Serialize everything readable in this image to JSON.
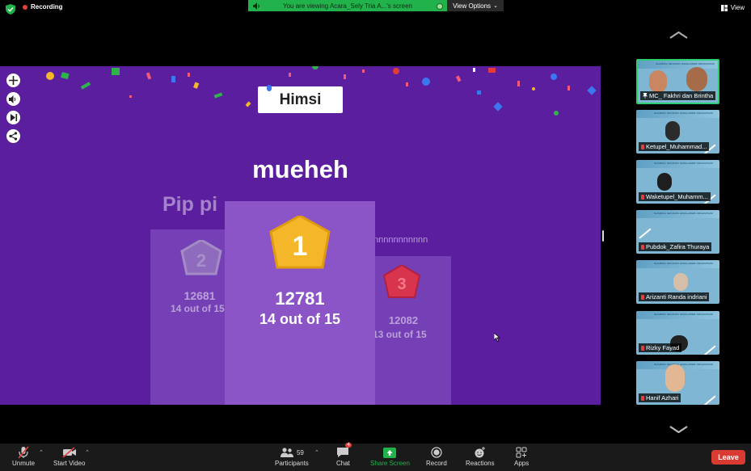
{
  "topbar": {
    "recording_label": "Recording",
    "banner_text": "You are viewing Acara_Sely Tria A...'s screen",
    "view_options_label": "View Options",
    "view_label": "View"
  },
  "screen": {
    "team_name": "Himsi",
    "first_player": "mueheh",
    "second_player": "Pip pi",
    "third_player": "nnnnnnnnnnn",
    "podium": [
      {
        "rank": "1",
        "score": "12781",
        "detail": "14 out of 15"
      },
      {
        "rank": "2",
        "score": "12681",
        "detail": "14 out of 15"
      },
      {
        "rank": "3",
        "score": "12082",
        "detail": "13 out of 15"
      }
    ]
  },
  "participants": [
    {
      "name": "MC_ Fakhri dan Brintha"
    },
    {
      "name": "Ketupel_Muhammad..."
    },
    {
      "name": "Waketupel_Muhamm..."
    },
    {
      "name": "Pubdok_Zafira Thuraya"
    },
    {
      "name": "Arizanti Randa indriani"
    },
    {
      "name": "Rizky Fayad"
    },
    {
      "name": "Hanif Azhari"
    }
  ],
  "thumbnail_header": "SHARING SESSION HIMALAWEB ORGANISASI",
  "toolbar": {
    "unmute": "Unmute",
    "start_video": "Start Video",
    "participants": "Participants",
    "participants_count": "59",
    "chat": "Chat",
    "chat_badge": "4",
    "share_screen": "Share Screen",
    "record": "Record",
    "reactions": "Reactions",
    "apps": "Apps",
    "leave": "Leave"
  },
  "colors": {
    "accent_green": "#22b24c",
    "leave_red": "#d93a31",
    "screen_purple": "#5a1e9e",
    "gold": "#f4b72a",
    "red_badge": "#d8344e"
  }
}
